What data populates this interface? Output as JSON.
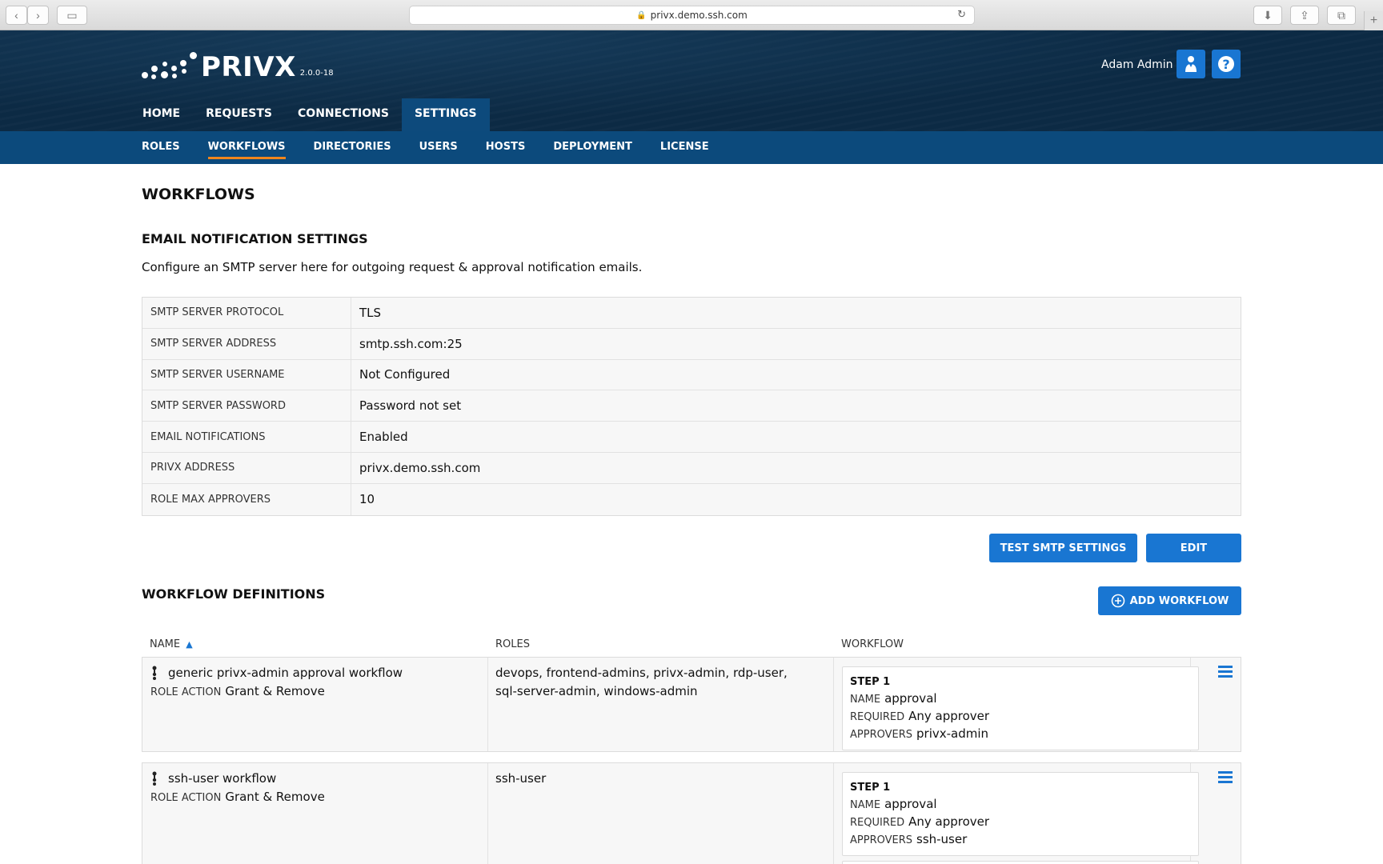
{
  "browser": {
    "url": "privx.demo.ssh.com",
    "back_glyph": "‹",
    "forward_glyph": "›",
    "sidebar_glyph": "▭",
    "download_glyph": "⬇",
    "share_glyph": "⇪",
    "tabs_glyph": "⧉",
    "newtab_glyph": "+",
    "reload_glyph": "↻"
  },
  "header": {
    "logo_text": "PRIVX",
    "version": "2.0.0-18",
    "user_name": "Adam Admin",
    "help_glyph": "?",
    "main_nav": [
      {
        "label": "HOME"
      },
      {
        "label": "REQUESTS"
      },
      {
        "label": "CONNECTIONS"
      },
      {
        "label": "SETTINGS",
        "active": true
      }
    ]
  },
  "subnav": [
    {
      "label": "ROLES"
    },
    {
      "label": "WORKFLOWS",
      "active": true
    },
    {
      "label": "DIRECTORIES"
    },
    {
      "label": "USERS"
    },
    {
      "label": "HOSTS"
    },
    {
      "label": "DEPLOYMENT"
    },
    {
      "label": "LICENSE"
    }
  ],
  "page": {
    "title": "WORKFLOWS",
    "email_section_title": "EMAIL NOTIFICATION SETTINGS",
    "email_description": "Configure an SMTP server here for outgoing request & approval notification emails.",
    "settings": [
      {
        "label": "SMTP SERVER PROTOCOL",
        "value": "TLS"
      },
      {
        "label": "SMTP SERVER ADDRESS",
        "value": "smtp.ssh.com:25"
      },
      {
        "label": "SMTP SERVER USERNAME",
        "value": "Not Configured"
      },
      {
        "label": "SMTP SERVER PASSWORD",
        "value": "Password not set"
      },
      {
        "label": "EMAIL NOTIFICATIONS",
        "value": "Enabled"
      },
      {
        "label": "PRIVX ADDRESS",
        "value": "privx.demo.ssh.com"
      },
      {
        "label": "ROLE MAX APPROVERS",
        "value": "10"
      }
    ],
    "test_smtp_label": "TEST SMTP SETTINGS",
    "edit_label": "EDIT",
    "definitions_title": "WORKFLOW DEFINITIONS",
    "add_workflow_label": "ADD WORKFLOW",
    "columns": {
      "name": "NAME",
      "sort_glyph": "▲",
      "roles": "ROLES",
      "workflow": "WORKFLOW"
    },
    "labels": {
      "role_action": "ROLE ACTION",
      "name": "NAME",
      "required": "REQUIRED",
      "approvers": "APPROVERS"
    },
    "workflows": [
      {
        "name": "generic privx-admin approval workflow",
        "role_action": "Grant & Remove",
        "roles": "devops, frontend-admins, privx-admin, rdp-user, sql-server-admin, windows-admin",
        "step_title": "STEP 1",
        "step_name": "approval",
        "step_required": "Any approver",
        "step_approvers": "privx-admin"
      },
      {
        "name": "ssh-user workflow",
        "role_action": "Grant & Remove",
        "roles": "ssh-user",
        "step_title": "STEP 1",
        "step_name": "approval",
        "step_required": "Any approver",
        "step_approvers": "ssh-user"
      }
    ]
  }
}
